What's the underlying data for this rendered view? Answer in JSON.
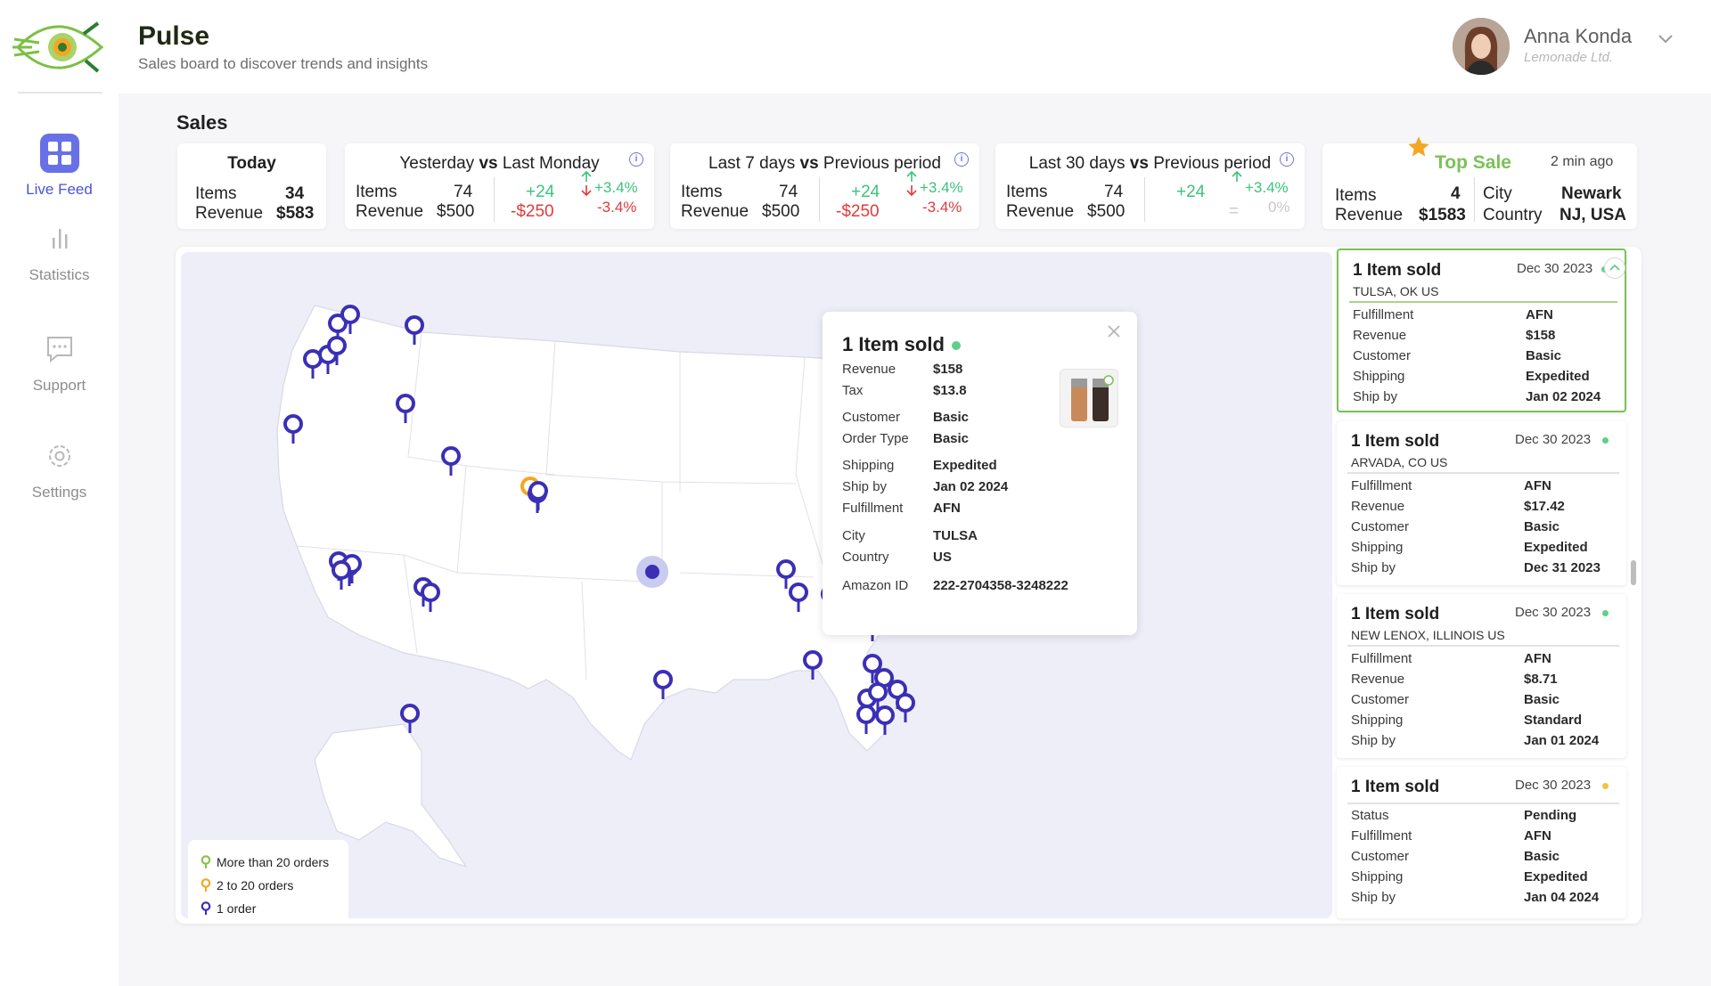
{
  "app": {
    "title": "Pulse",
    "subtitle": "Sales board to discover trends and insights"
  },
  "user": {
    "name": "Anna Konda",
    "company": "Lemonade Ltd."
  },
  "sidebar": {
    "items": [
      {
        "label": "Live Feed",
        "icon": "grid-icon",
        "active": true
      },
      {
        "label": "Statistics",
        "icon": "bar-chart-icon",
        "active": false
      },
      {
        "label": "Support",
        "icon": "chat-icon",
        "active": false
      },
      {
        "label": "Settings",
        "icon": "gear-icon",
        "active": false
      }
    ]
  },
  "sales": {
    "title": "Sales",
    "today": {
      "title": "Today",
      "items_label": "Items",
      "items": "34",
      "revenue_label": "Revenue",
      "revenue": "$583"
    },
    "yesterday": {
      "title_a": "Yesterday",
      "vs": "vs",
      "title_b": "Last Monday",
      "items_label": "Items",
      "items": "74",
      "revenue_label": "Revenue",
      "revenue": "$500",
      "items_diff": "+24",
      "revenue_diff": "-$250",
      "items_pct": "+3.4%",
      "revenue_pct": "-3.4%"
    },
    "last7": {
      "title_a": "Last 7 days",
      "vs": "vs",
      "title_b": "Previous period",
      "items_label": "Items",
      "items": "74",
      "revenue_label": "Revenue",
      "revenue": "$500",
      "items_diff": "+24",
      "revenue_diff": "-$250",
      "items_pct": "+3.4%",
      "revenue_pct": "-3.4%"
    },
    "last30": {
      "title_a": "Last 30 days",
      "vs": "vs",
      "title_b": "Previous period",
      "items_label": "Items",
      "items": "74",
      "revenue_label": "Revenue",
      "revenue": "$500",
      "items_diff": "+24",
      "revenue_diff": "=",
      "items_pct": "+3.4%",
      "revenue_pct": "0%"
    },
    "top_sale": {
      "title": "Top Sale",
      "time": "2 min ago",
      "items_label": "Items",
      "items": "4",
      "revenue_label": "Revenue",
      "revenue": "$1583",
      "city_label": "City",
      "city": "Newark",
      "country_label": "Country",
      "country": "NJ, USA"
    }
  },
  "legend": {
    "items": [
      {
        "label": "More than 20 orders",
        "color": "#8bc34a"
      },
      {
        "label": "2 to 20 orders",
        "color": "#f5a623"
      },
      {
        "label": "1 order",
        "color": "#3b2fb5"
      }
    ]
  },
  "popup": {
    "title": "1 Item sold",
    "rows": [
      {
        "k": "Revenue",
        "v": "$158"
      },
      {
        "k": "Tax",
        "v": "$13.8"
      },
      {
        "k": "Customer",
        "v": "Basic"
      },
      {
        "k": "Order Type",
        "v": "Basic"
      },
      {
        "k": "Shipping",
        "v": "Expedited"
      },
      {
        "k": "Ship by",
        "v": "Jan 02 2024"
      },
      {
        "k": "Fulfillment",
        "v": "AFN"
      },
      {
        "k": "City",
        "v": "TULSA"
      },
      {
        "k": "Country",
        "v": "US"
      },
      {
        "k": "Amazon ID",
        "v": "222-2704358-3248222"
      }
    ]
  },
  "feed": [
    {
      "title": "1 Item sold",
      "date": "Dec 30 2023",
      "status_color": "#5fcf8a",
      "city": "TULSA, OK US",
      "rows": [
        {
          "k": "Fulfillment",
          "v": "AFN"
        },
        {
          "k": "Revenue",
          "v": "$158"
        },
        {
          "k": "Customer",
          "v": "Basic"
        },
        {
          "k": "Shipping",
          "v": "Expedited"
        },
        {
          "k": "Ship by",
          "v": "Jan 02 2024"
        }
      ]
    },
    {
      "title": "1 Item sold",
      "date": "Dec 30 2023",
      "status_color": "#5fcf8a",
      "city": "ARVADA, CO US",
      "rows": [
        {
          "k": "Fulfillment",
          "v": "AFN"
        },
        {
          "k": "Revenue",
          "v": "$17.42"
        },
        {
          "k": "Customer",
          "v": "Basic"
        },
        {
          "k": "Shipping",
          "v": "Expedited"
        },
        {
          "k": "Ship by",
          "v": "Dec 31 2023"
        }
      ]
    },
    {
      "title": "1 Item sold",
      "date": "Dec 30 2023",
      "status_color": "#5fcf8a",
      "city": "NEW LENOX, ILLINOIS US",
      "rows": [
        {
          "k": "Fulfillment",
          "v": "AFN"
        },
        {
          "k": "Revenue",
          "v": "$8.71"
        },
        {
          "k": "Customer",
          "v": "Basic"
        },
        {
          "k": "Shipping",
          "v": "Standard"
        },
        {
          "k": "Ship by",
          "v": "Jan 01 2024"
        }
      ]
    },
    {
      "title": "1 Item sold",
      "date": "Dec 30 2023",
      "status_color": "#f5c04a",
      "city": "",
      "rows": [
        {
          "k": "Status",
          "v": "Pending"
        },
        {
          "k": "Fulfillment",
          "v": "AFN"
        },
        {
          "k": "Customer",
          "v": "Basic"
        },
        {
          "k": "Shipping",
          "v": "Expedited"
        },
        {
          "k": "Ship by",
          "v": "Jan 04 2024"
        }
      ]
    }
  ],
  "colors": {
    "accent": "#4b53d9",
    "pin": "#3b2fb5",
    "positive": "#3ec27d",
    "negative": "#e03b3b",
    "highlight": "#7cc15a"
  }
}
